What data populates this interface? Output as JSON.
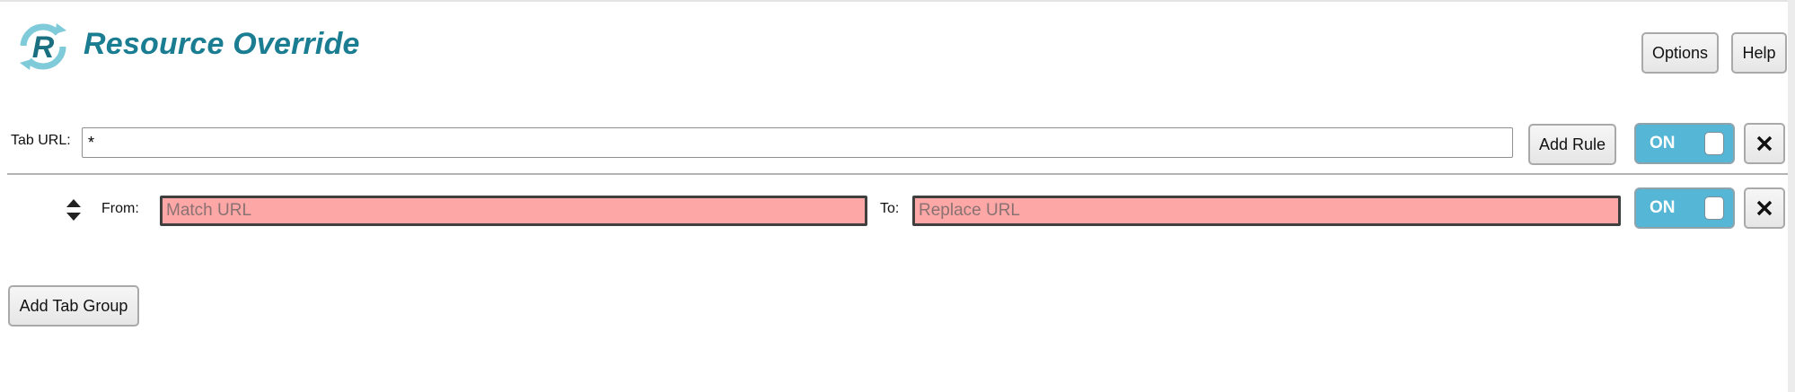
{
  "header": {
    "title": "Resource Override",
    "options_label": "Options",
    "help_label": "Help",
    "logo_letter": "R",
    "accent_color": "#1a7d91"
  },
  "tab_group": {
    "tab_url_label": "Tab URL:",
    "tab_url_value": "*",
    "add_rule_label": "Add Rule",
    "toggle_label": "ON",
    "toggle_state": "on",
    "close_icon": "close-icon",
    "rules": [
      {
        "from_label": "From:",
        "from_value": "",
        "from_placeholder": "Match URL",
        "to_label": "To:",
        "to_value": "",
        "to_placeholder": "Replace URL",
        "toggle_label": "ON",
        "toggle_state": "on",
        "invalid_color": "#fea7a7"
      }
    ]
  },
  "footer": {
    "add_tab_group_label": "Add Tab Group"
  },
  "colors": {
    "toggle_on": "#55b6d6",
    "invalid_field": "#fea7a7"
  }
}
